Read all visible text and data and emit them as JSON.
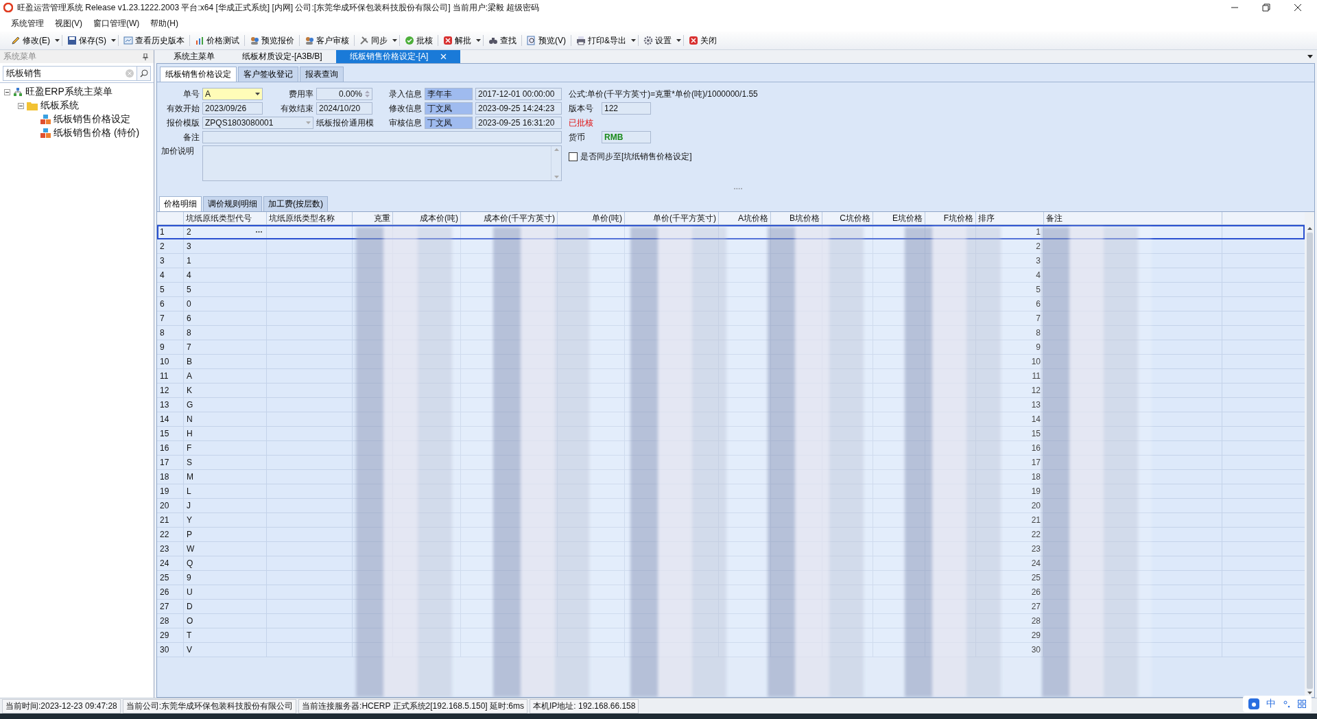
{
  "window": {
    "title": "旺盈运营管理系统 Release v1.23.1222.2003 平台:x64  [华成正式系统] [内网] 公司:[东莞华成环保包装科技股份有限公司] 当前用户:梁毅  超级密码"
  },
  "menu": [
    "系统管理",
    "视图(V)",
    "窗口管理(W)",
    "帮助(H)"
  ],
  "toolbar": [
    {
      "label": "修改(E)",
      "dropdown": true
    },
    {
      "label": "保存(S)",
      "dropdown": true
    },
    {
      "label": "查看历史版本",
      "dropdown": false
    },
    {
      "label": "价格测试",
      "dropdown": false
    },
    {
      "label": "预览报价",
      "dropdown": false
    },
    {
      "label": "客户审核",
      "dropdown": false
    },
    {
      "label": "同步",
      "dropdown": true
    },
    {
      "label": "批核",
      "dropdown": false
    },
    {
      "label": "解批",
      "dropdown": true
    },
    {
      "label": "查找",
      "dropdown": false
    },
    {
      "label": "预览(V)",
      "dropdown": false
    },
    {
      "label": "打印&导出",
      "dropdown": true
    },
    {
      "label": "设置",
      "dropdown": true
    },
    {
      "label": "关闭",
      "dropdown": false
    }
  ],
  "sidebar": {
    "title": "系统菜单",
    "search": "纸板销售",
    "tree": [
      {
        "label": "旺盈ERP系统主菜单",
        "expanded": true,
        "children": [
          {
            "label": "纸板系统",
            "expanded": true,
            "children": [
              {
                "label": "纸板销售价格设定"
              },
              {
                "label": "纸板销售价格 (特价)"
              }
            ]
          }
        ]
      }
    ]
  },
  "doc_tabs": [
    {
      "label": "系统主菜单",
      "selected": false
    },
    {
      "label": "纸板材质设定-[A3B/B]",
      "selected": false
    },
    {
      "label": "纸板销售价格设定-[A]",
      "selected": true
    }
  ],
  "form_tabs": [
    {
      "label": "纸板销售价格设定",
      "selected": true
    },
    {
      "label": "客户签收登记",
      "selected": false
    },
    {
      "label": "报表查询",
      "selected": false
    }
  ],
  "form": {
    "order_no": {
      "label": "单号",
      "value": "A"
    },
    "fee_rate": {
      "label": "费用率",
      "value": "0.00%"
    },
    "entry": {
      "label": "录入信息",
      "user": "李年丰",
      "time": "2017-12-01 00:00:00"
    },
    "formula": "公式:单价(千平方英寸)=克重*单价(吨)/1000000/1.55",
    "valid_start": {
      "label": "有效开始",
      "value": "2023/09/26"
    },
    "valid_end": {
      "label": "有效结束",
      "value": "2024/10/20"
    },
    "modified": {
      "label": "修改信息",
      "user": "丁文凤",
      "time": "2023-09-25 14:24:23"
    },
    "version": {
      "label": "版本号",
      "value": "122"
    },
    "template": {
      "label": "报价模版",
      "value": "ZPQS1803080001",
      "name": "纸板报价通用模"
    },
    "review": {
      "label": "审核信息",
      "user": "丁文凤",
      "time": "2023-09-25 16:31:20"
    },
    "status": "已批核",
    "remark": {
      "label": "备注"
    },
    "currency": {
      "label": "货币",
      "value": "RMB"
    },
    "markup": {
      "label": "加价说明"
    },
    "sync": {
      "label": "是否同步至[坑纸销售价格设定]",
      "checked": false
    }
  },
  "grid_tabs": [
    {
      "label": "价格明细",
      "selected": true
    },
    {
      "label": "调价规则明细",
      "selected": false
    },
    {
      "label": "加工费(按层数)",
      "selected": false
    }
  ],
  "table": {
    "columns": [
      "坑纸原纸类型代号",
      "坑纸原纸类型名称",
      "克重",
      "成本价(吨)",
      "成本价(千平方英寸)",
      "单价(吨)",
      "单价(千平方英寸)",
      "A坑价格",
      "B坑价格",
      "C坑价格",
      "E坑价格",
      "F坑价格",
      "排序",
      "备注"
    ],
    "rows": [
      {
        "no": "1",
        "code": "2",
        "sort": "1",
        "selected": true
      },
      {
        "no": "2",
        "code": "3",
        "sort": "2",
        "selected": false
      },
      {
        "no": "3",
        "code": "1",
        "sort": "3",
        "selected": false
      },
      {
        "no": "4",
        "code": "4",
        "sort": "4",
        "selected": false
      },
      {
        "no": "5",
        "code": "5",
        "sort": "5",
        "selected": false
      },
      {
        "no": "6",
        "code": "0",
        "sort": "6",
        "selected": false
      },
      {
        "no": "7",
        "code": "6",
        "sort": "7",
        "selected": false
      },
      {
        "no": "8",
        "code": "8",
        "sort": "8",
        "selected": false
      },
      {
        "no": "9",
        "code": "7",
        "sort": "9",
        "selected": false
      },
      {
        "no": "10",
        "code": "B",
        "sort": "10",
        "selected": false
      },
      {
        "no": "11",
        "code": "A",
        "sort": "11",
        "selected": false
      },
      {
        "no": "12",
        "code": "K",
        "sort": "12",
        "selected": false
      },
      {
        "no": "13",
        "code": "G",
        "sort": "13",
        "selected": false
      },
      {
        "no": "14",
        "code": "N",
        "sort": "14",
        "selected": false
      },
      {
        "no": "15",
        "code": "H",
        "sort": "15",
        "selected": false
      },
      {
        "no": "16",
        "code": "F",
        "sort": "16",
        "selected": false
      },
      {
        "no": "17",
        "code": "S",
        "sort": "17",
        "selected": false
      },
      {
        "no": "18",
        "code": "M",
        "sort": "18",
        "selected": false
      },
      {
        "no": "19",
        "code": "L",
        "sort": "19",
        "selected": false
      },
      {
        "no": "20",
        "code": "J",
        "sort": "20",
        "selected": false
      },
      {
        "no": "21",
        "code": "Y",
        "sort": "21",
        "selected": false
      },
      {
        "no": "22",
        "code": "P",
        "sort": "22",
        "selected": false
      },
      {
        "no": "23",
        "code": "W",
        "sort": "23",
        "selected": false
      },
      {
        "no": "24",
        "code": "Q",
        "sort": "24",
        "selected": false
      },
      {
        "no": "25",
        "code": "9",
        "sort": "25",
        "selected": false
      },
      {
        "no": "26",
        "code": "U",
        "sort": "26",
        "selected": false
      },
      {
        "no": "27",
        "code": "D",
        "sort": "27",
        "selected": false
      },
      {
        "no": "28",
        "code": "O",
        "sort": "28",
        "selected": false
      },
      {
        "no": "29",
        "code": "T",
        "sort": "29",
        "selected": false
      },
      {
        "no": "30",
        "code": "V",
        "sort": "30",
        "selected": false
      }
    ]
  },
  "status_bar": [
    "当前时间:2023-12-23 09:47:28",
    "当前公司:东莞华成环保包装科技股份有限公司",
    "当前连接服务器:HCERP 正式系统2[192.168.5.150] 延时:6ms",
    "本机IP地址: 192.168.66.158"
  ],
  "tray": {
    "ime": "中"
  }
}
